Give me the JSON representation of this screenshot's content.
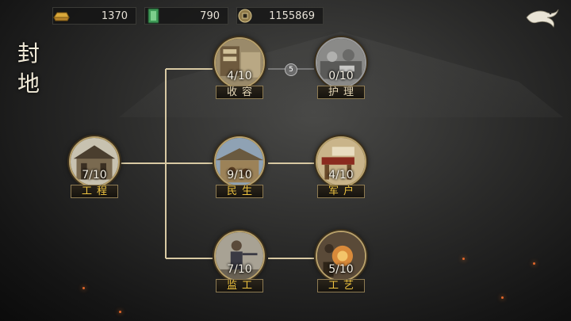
{
  "resources": [
    {
      "name": "gold-ingot",
      "value": "1370"
    },
    {
      "name": "jade-token",
      "value": "790"
    },
    {
      "name": "copper-coin",
      "value": "1155869"
    }
  ],
  "title": [
    "封",
    "地"
  ],
  "nodes": {
    "gongcheng": {
      "progress": "7/10",
      "label": "工程"
    },
    "shourong": {
      "progress": "4/10",
      "label": "收容"
    },
    "huli": {
      "progress": "0/10",
      "label": "护理"
    },
    "minsheng": {
      "progress": "9/10",
      "label": "民生"
    },
    "junhu": {
      "progress": "4/10",
      "label": "军户"
    },
    "jiangong": {
      "progress": "7/10",
      "label": "监工"
    },
    "gongyi": {
      "progress": "5/10",
      "label": "工艺"
    }
  },
  "unlock_requirement": "5",
  "colors": {
    "gold": "#f0c440",
    "line": "#d8c9a3",
    "frame": "#b8a06a"
  }
}
